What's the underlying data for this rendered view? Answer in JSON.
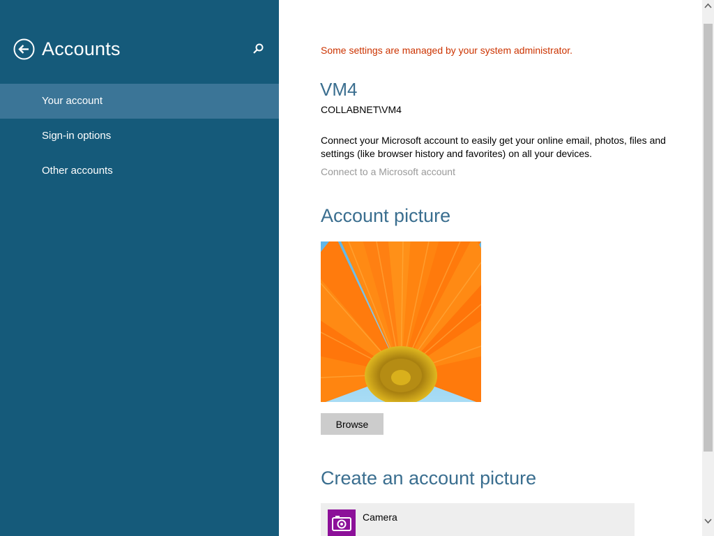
{
  "nav": {
    "title": "Accounts",
    "back_icon": "back-arrow-icon",
    "search_icon": "search-icon",
    "items": [
      {
        "label": "Your account",
        "selected": true
      },
      {
        "label": "Sign-in options",
        "selected": false
      },
      {
        "label": "Other accounts",
        "selected": false
      }
    ],
    "background_color": "#155a7a",
    "selected_color": "#3b7597"
  },
  "main": {
    "admin_notice": "Some settings are managed by your system administrator.",
    "user_name": "VM4",
    "user_domain": "COLLABNET\\VM4",
    "connect_description": "Connect your Microsoft account to easily get your online email, photos, files and settings (like browser history and favorites) on all your devices.",
    "connect_link": "Connect to a Microsoft account",
    "account_picture_heading": "Account picture",
    "browse_label": "Browse",
    "create_heading": "Create an account picture",
    "apps": [
      {
        "label": "Camera",
        "icon": "camera-icon",
        "icon_color": "#8c1099"
      }
    ],
    "notice_color": "#cc3300",
    "heading_color": "#3a6e8f"
  }
}
